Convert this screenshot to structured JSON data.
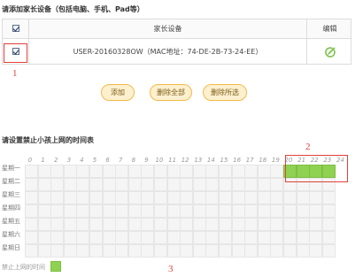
{
  "section1_title": "请添加家长设备（包括电脑、手机、Pad等）",
  "device_table": {
    "headers": {
      "device": "家长设备",
      "edit": "编辑"
    },
    "rows": [
      {
        "device": "USER-20160328OW（MAC地址：74-DE-2B-73-24-EE）",
        "checked": true
      }
    ]
  },
  "buttons": {
    "add": "添加",
    "delete_all": "删除全部",
    "delete_selected": "删除所选"
  },
  "section2_title": "请设置禁止小孩上网的时间表",
  "hours": [
    "0",
    "1",
    "2",
    "3",
    "4",
    "5",
    "6",
    "7",
    "8",
    "9",
    "10",
    "11",
    "12",
    "13",
    "14",
    "15",
    "16",
    "17",
    "18",
    "19",
    "20",
    "21",
    "22",
    "23",
    "24"
  ],
  "days": [
    "星期一",
    "星期二",
    "星期三",
    "星期四",
    "星期五",
    "星期六",
    "星期日"
  ],
  "blocked": [
    {
      "day": 0,
      "hours": [
        20,
        21,
        22,
        23
      ]
    }
  ],
  "legend_label": "禁止上网的时间",
  "annotations": [
    "1",
    "2",
    "3"
  ],
  "colors": {
    "blocked_green": "#8fd151",
    "annotation_red": "#e0413b",
    "button_fill": "#fdf0cf",
    "button_border": "#f2ba4a"
  }
}
